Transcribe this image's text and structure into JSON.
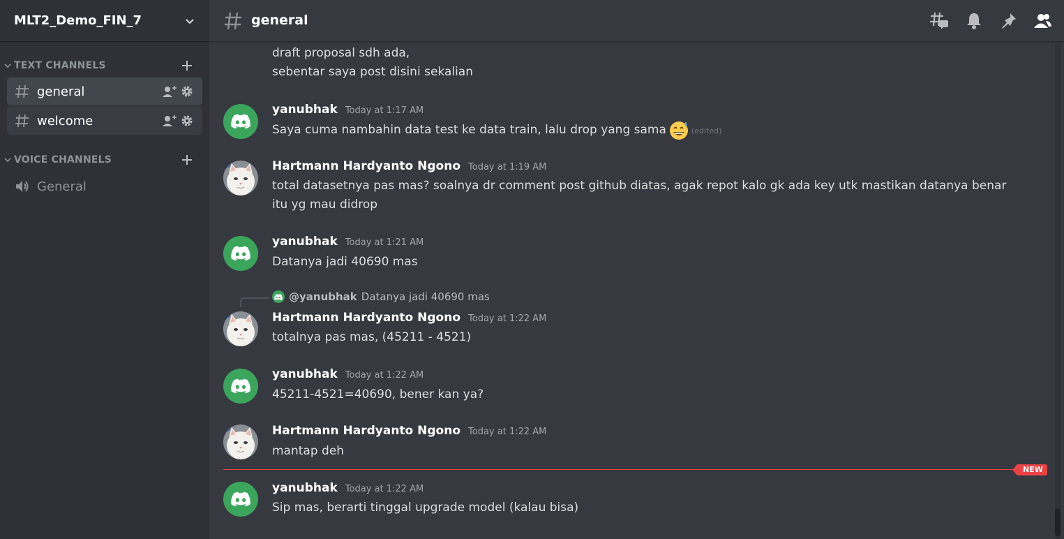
{
  "server": {
    "name": "MLT2_Demo_FIN_7"
  },
  "sidebar": {
    "text_category": "TEXT CHANNELS",
    "voice_category": "VOICE CHANNELS",
    "text_channels": [
      {
        "label": "general",
        "active": true
      },
      {
        "label": "welcome",
        "active": false
      }
    ],
    "voice_channels": [
      {
        "label": "General"
      }
    ]
  },
  "header": {
    "channel": "general"
  },
  "messages": {
    "cont_line1": "draft proposal sdh ada,",
    "cont_line2": "sebentar saya post disini sekalian",
    "m1": {
      "author": "yanubhak",
      "time": "Today at 1:17 AM",
      "text": "Saya cuma nambahin data test ke data train, lalu drop yang sama",
      "edited": "(edited)"
    },
    "m2": {
      "author": "Hartmann Hardyanto Ngono",
      "time": "Today at 1:19 AM",
      "text": "total datasetnya pas mas? soalnya dr comment post github diatas, agak repot kalo gk ada key utk mastikan datanya benar itu yg mau didrop"
    },
    "m3": {
      "author": "yanubhak",
      "time": "Today at 1:21 AM",
      "text": "Datanya jadi 40690 mas"
    },
    "m4": {
      "reply_author": "@yanubhak",
      "reply_text": "Datanya jadi 40690 mas",
      "author": "Hartmann Hardyanto Ngono",
      "time": "Today at 1:22 AM",
      "text": "totalnya pas mas, (45211 - 4521)"
    },
    "m5": {
      "author": "yanubhak",
      "time": "Today at 1:22 AM",
      "text": "45211-4521=40690, bener kan ya?"
    },
    "m6": {
      "author": "Hartmann Hardyanto Ngono",
      "time": "Today at 1:22 AM",
      "text": "mantap deh"
    },
    "new_label": "NEW",
    "m7": {
      "author": "yanubhak",
      "time": "Today at 1:22 AM",
      "text": "Sip mas, berarti tinggal upgrade model (kalau bisa)"
    }
  },
  "colors": {
    "discord_green": "#3ba55c",
    "new_red": "#ed4245",
    "sidebar_bg": "#2f3136",
    "main_bg": "#36393f"
  }
}
